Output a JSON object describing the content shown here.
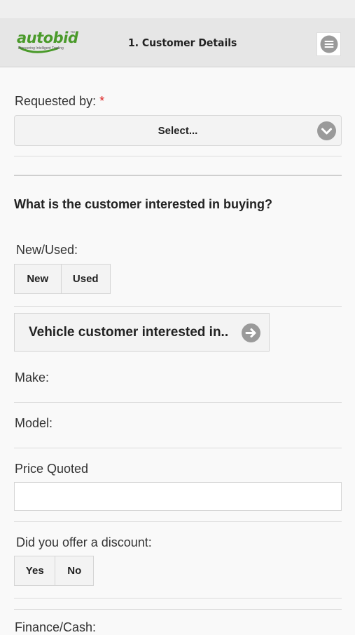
{
  "header": {
    "logo_text": "autobid",
    "logo_tm": "™",
    "logo_tagline": "Pioneering Intelligent Trading",
    "title": "1. Customer Details"
  },
  "form": {
    "requested_by_label": "Requested by:",
    "required_mark": "*",
    "requested_by_value": "Select...",
    "question": "What is the customer interested in buying?",
    "new_used_label": "New/Used:",
    "new_label": "New",
    "used_label": "Used",
    "vehicle_button_label": "Vehicle customer interested in..",
    "make_label": "Make:",
    "model_label": "Model:",
    "price_label": "Price Quoted",
    "price_value": "",
    "discount_label": "Did you offer a discount:",
    "yes_label": "Yes",
    "no_label": "No",
    "finance_label": "Finance/Cash:"
  },
  "colors": {
    "brand_green": "#4a9a2a",
    "required_red": "#dd2222",
    "icon_gray": "#9a9a9a"
  },
  "icons": {
    "menu": "hamburger-circle-icon",
    "select": "chevron-down-circle-icon",
    "vehicle": "arrow-right-circle-icon"
  }
}
